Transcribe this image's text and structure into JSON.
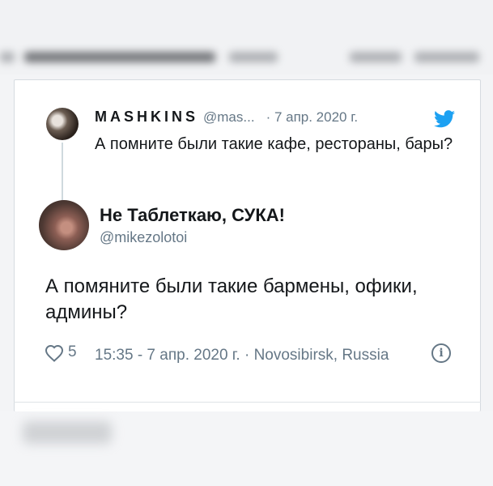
{
  "quoted_tweet": {
    "author_name": "MASHKINS",
    "handle": "@mas...",
    "date": "· 7 апр. 2020 г.",
    "text": "А помните были такие кафе, рестораны, бары?"
  },
  "tweet": {
    "author_name": "Не Таблеткаю, СУКА!",
    "handle": "@mikezolotoi",
    "text": "А помяните были такие бармены, офики, админы?",
    "like_count": "5",
    "meta": "15:35 - 7 апр. 2020 г. · Novosibirsk, Russia"
  },
  "colors": {
    "text": "#14171a",
    "secondary": "#657786",
    "twitter_blue": "#1da1f2"
  },
  "icons": [
    "twitter-bird-icon",
    "heart-icon",
    "info-icon"
  ]
}
